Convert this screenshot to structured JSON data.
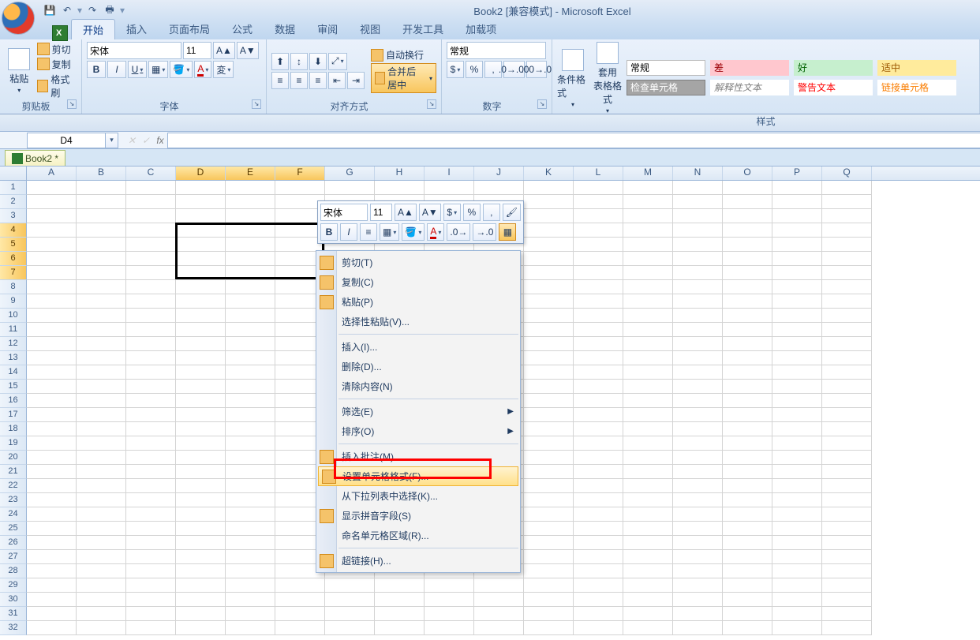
{
  "title": "Book2  [兼容模式] - Microsoft Excel",
  "qat": {
    "save": "save-icon",
    "undo": "undo-icon",
    "redo": "redo-icon",
    "print": "print-icon",
    "more": "more-icon"
  },
  "tabs": [
    "开始",
    "插入",
    "页面布局",
    "公式",
    "数据",
    "审阅",
    "视图",
    "开发工具",
    "加载项"
  ],
  "clipboard": {
    "paste": "粘贴",
    "cut": "剪切",
    "copy": "复制",
    "fmt": "格式刷",
    "label": "剪贴板"
  },
  "font": {
    "name": "宋体",
    "size": "11",
    "bold": "B",
    "italic": "I",
    "underline": "U",
    "label": "字体"
  },
  "align": {
    "wrap": "自动换行",
    "merge": "合并后居中",
    "label": "对齐方式"
  },
  "number": {
    "fmt": "常规",
    "label": "数字"
  },
  "stylebtns": {
    "cond": "条件格式",
    "tbl": "套用\n表格格式",
    "label": "样式"
  },
  "styles": [
    {
      "t": "常规",
      "bg": "#ffffff",
      "fg": "#000000",
      "b": "#bbbbbb"
    },
    {
      "t": "差",
      "bg": "#ffc7ce",
      "fg": "#9c0006",
      "b": "#ffc7ce"
    },
    {
      "t": "好",
      "bg": "#c6efce",
      "fg": "#006100",
      "b": "#c6efce"
    },
    {
      "t": "适中",
      "bg": "#ffeb9c",
      "fg": "#9c5700",
      "b": "#ffeb9c"
    },
    {
      "t": "检查单元格",
      "bg": "#a5a5a5",
      "fg": "#ffffff",
      "b": "#7f7f7f"
    },
    {
      "t": "解释性文本",
      "bg": "#ffffff",
      "fg": "#7f7f7f",
      "b": "#ffffff",
      "it": true
    },
    {
      "t": "警告文本",
      "bg": "#ffffff",
      "fg": "#ff0000",
      "b": "#ffffff"
    },
    {
      "t": "链接单元格",
      "bg": "#ffffff",
      "fg": "#fa7d00",
      "b": "#ffffff"
    }
  ],
  "namebox": "D4",
  "wbname": "Book2 *",
  "cols": [
    "A",
    "B",
    "C",
    "D",
    "E",
    "F",
    "G",
    "H",
    "I",
    "J",
    "K",
    "L",
    "M",
    "N",
    "O",
    "P",
    "Q"
  ],
  "selcols": [
    "D",
    "E",
    "F"
  ],
  "rowcount": 32,
  "selrows": [
    4,
    5,
    6,
    7
  ],
  "selection": {
    "col": 3,
    "row": 3,
    "w": 3,
    "h": 4
  },
  "miniToolbar": {
    "font": "宋体",
    "size": "11"
  },
  "ctx": [
    {
      "t": "剪切(T)",
      "i": true,
      "key": "cut"
    },
    {
      "t": "复制(C)",
      "i": true,
      "key": "copy"
    },
    {
      "t": "粘贴(P)",
      "i": true,
      "key": "paste"
    },
    {
      "t": "选择性粘贴(V)...",
      "key": "paste-special"
    },
    {
      "sep": true
    },
    {
      "t": "插入(I)...",
      "key": "insert"
    },
    {
      "t": "删除(D)...",
      "key": "delete"
    },
    {
      "t": "清除内容(N)",
      "key": "clear"
    },
    {
      "sep": true
    },
    {
      "t": "筛选(E)",
      "arrow": true,
      "key": "filter"
    },
    {
      "t": "排序(O)",
      "arrow": true,
      "key": "sort"
    },
    {
      "sep": true
    },
    {
      "t": "插入批注(M)",
      "i": true,
      "key": "comment"
    },
    {
      "t": "设置单元格格式(F)...",
      "i": true,
      "hl": true,
      "key": "format-cells"
    },
    {
      "t": "从下拉列表中选择(K)...",
      "key": "pick-list"
    },
    {
      "t": "显示拼音字段(S)",
      "i": true,
      "key": "phonetic"
    },
    {
      "t": "命名单元格区域(R)...",
      "key": "name-range"
    },
    {
      "sep": true
    },
    {
      "t": "超链接(H)...",
      "i": true,
      "key": "hyperlink"
    }
  ]
}
